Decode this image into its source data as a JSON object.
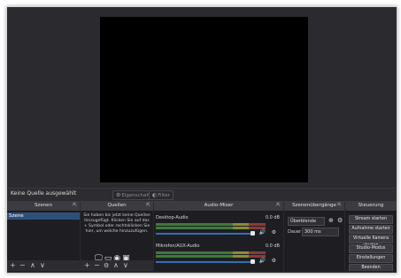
{
  "preview": {},
  "source_bar": {
    "no_source_text": "Keine Quelle ausgewählt",
    "properties_label": "Eigenschaften",
    "filters_label": "Filter",
    "gear_icon": "gear-icon"
  },
  "docks": {
    "scenes": {
      "title": "Szenen",
      "items": [
        "Szene"
      ],
      "toolbar_icons": [
        "+",
        "−",
        "∧",
        "∨"
      ]
    },
    "sources": {
      "title": "Quellen",
      "empty_text": "Sie haben bis jetzt keine Quellen hinzugefügt. Klicken Sie auf das + Symbol oder rechtsklicken Sie hier, um welche hinzuzufügen.",
      "source_type_icons": [
        "monitor-icon",
        "window-icon",
        "browser-icon",
        "camera-icon"
      ],
      "toolbar_icons": [
        "+",
        "−",
        "⚙",
        "∧",
        "∨"
      ]
    },
    "mixer": {
      "title": "Audio-Mixer",
      "channels": [
        {
          "name": "Desktop-Audio",
          "db": "0.0 dB",
          "level": 0.72
        },
        {
          "name": "Mikrofon/AUX-Audio",
          "db": "0.0 dB",
          "level": 0.7
        }
      ]
    },
    "transitions": {
      "title": "Szenenübergänge",
      "transition_value": "Überblende",
      "duration_label": "Dauer",
      "duration_value": "300 ms"
    },
    "controls": {
      "title": "Steuerung",
      "buttons": [
        "Stream starten",
        "Aufnahme starten",
        "Virtuelle Kamera starten",
        "Studio-Modus",
        "Einstellungen",
        "Beenden"
      ]
    }
  },
  "colors": {
    "preview_bg": "#000000",
    "app_bg": "#2a2a2e",
    "accent_blue": "#2f6fb5",
    "meter_green": "#3d7a3d"
  }
}
